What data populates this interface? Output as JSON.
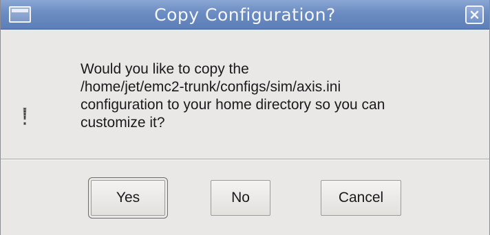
{
  "window": {
    "title": "Copy Configuration?",
    "titlebar_color": "#6b8cc2"
  },
  "icons": {
    "menu": "window-menu-icon",
    "close": "close-icon",
    "message": "warning-icon"
  },
  "message": {
    "lines": [
      "Would you like to copy the",
      "/home/jet/emc2-trunk/configs/sim/axis.ini",
      "configuration to your home directory so you can",
      "customize it?"
    ]
  },
  "buttons": {
    "yes_label": "Yes",
    "no_label": "No",
    "cancel_label": "Cancel",
    "default": "Yes"
  }
}
